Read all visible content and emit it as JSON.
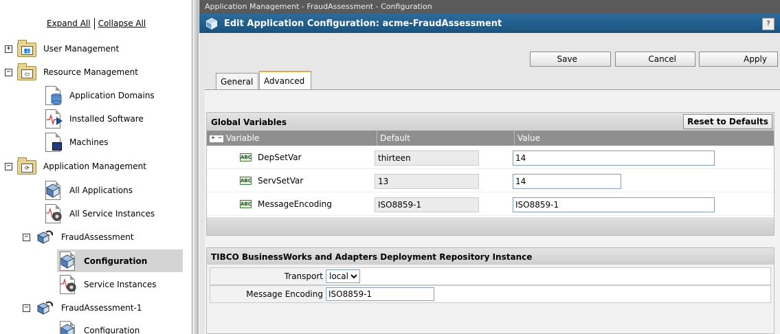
{
  "tree": {
    "expand_all": "Expand All",
    "collapse_all": "Collapse All",
    "nodes": [
      {
        "label": "User Management",
        "toggle": "+",
        "icon": "users-folder-icon"
      },
      {
        "label": "Resource Management",
        "toggle": "−",
        "icon": "resource-folder-icon"
      },
      {
        "label": "Application Domains",
        "icon": "database-icon"
      },
      {
        "label": "Installed Software",
        "icon": "software-icon"
      },
      {
        "label": "Machines",
        "icon": "machine-icon"
      },
      {
        "label": "Application Management",
        "toggle": "−",
        "icon": "application-folder-icon"
      },
      {
        "label": "All Applications",
        "icon": "cube-icon"
      },
      {
        "label": "All Service Instances",
        "icon": "service-gear-icon"
      },
      {
        "label": "FraudAssessment",
        "toggle": "−",
        "icon": "cube-arrow-icon"
      },
      {
        "label": "Configuration",
        "icon": "cube-icon",
        "selected": true
      },
      {
        "label": "Service Instances",
        "icon": "service-gear-icon"
      },
      {
        "label": "FraudAssessment-1",
        "toggle": "−",
        "icon": "cube-arrow-icon"
      },
      {
        "label": "Configuration",
        "icon": "cube-icon"
      }
    ]
  },
  "breadcrumb": "Application Management - FraudAssessment - Configuration",
  "title": "Edit Application Configuration: acme-FraudAssessment",
  "help": "?",
  "toolbar": {
    "save": "Save",
    "cancel": "Cancel",
    "apply": "Apply"
  },
  "tabs": {
    "general": "General",
    "advanced": "Advanced"
  },
  "global_variables": {
    "title": "Global Variables",
    "reset": "Reset to Defaults",
    "columns": {
      "variable": "Variable",
      "default": "Default",
      "value": "Value"
    },
    "rows": [
      {
        "type": "ABC",
        "name": "DepSetVar",
        "default": "thirteen",
        "value": "14"
      },
      {
        "type": "ABC",
        "name": "ServSetVar",
        "default": "13",
        "value": "14"
      },
      {
        "type": "ABC",
        "name": "MessageEncoding",
        "default": "ISO8859-1",
        "value": "ISO8859-1"
      }
    ]
  },
  "repository": {
    "title": "TIBCO BusinessWorks and Adapters Deployment Repository Instance",
    "transport_label": "Transport",
    "transport_value": "local",
    "encoding_label": "Message Encoding",
    "encoding_value": "ISO8859-1"
  },
  "colors": {
    "title_bar": "#1f5f8f",
    "tab_accent": "#e8a93a",
    "column_header": "#8f8f8f"
  }
}
